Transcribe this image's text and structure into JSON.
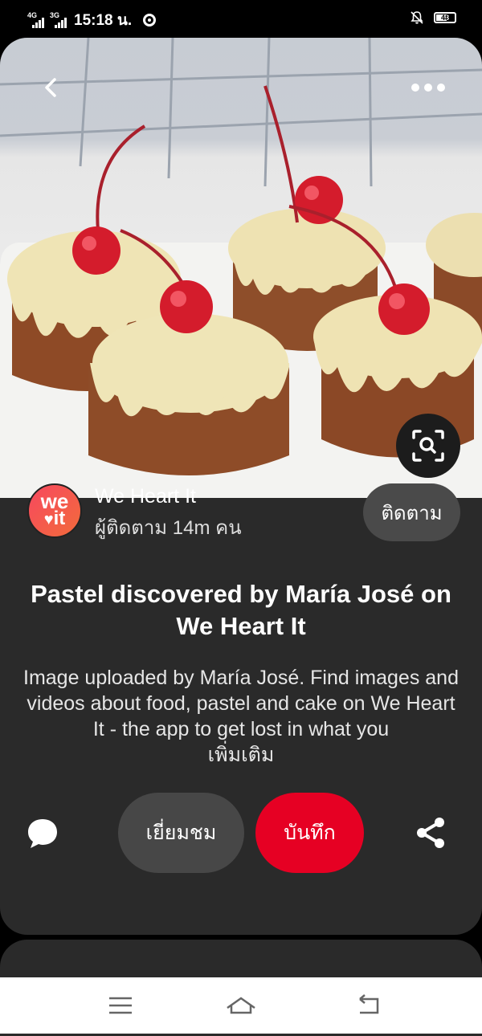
{
  "status_bar": {
    "network1": "4G",
    "network2": "3G",
    "time": "15:18 น.",
    "battery": "48"
  },
  "pin": {
    "image_alt": "mini cakes topped with white glaze and cherries",
    "publisher_name": "We Heart It",
    "publisher_logo_top": "we",
    "publisher_logo_bottom": "it",
    "followers": "ผู้ติดตาม 14m คน",
    "follow_label": "ติดตาม",
    "title": "Pastel discovered by María José on We Heart It",
    "description": "Image uploaded by María José. Find images and videos about food, pastel and cake on We Heart It - the app to get lost in what you",
    "more_label": "เพิ่มเติม",
    "visit_label": "เยี่ยมชม",
    "save_label": "บันทึก"
  },
  "colors": {
    "save": "#e60023",
    "card": "#2a2a2a",
    "secondary_button": "#474747"
  },
  "icons": [
    "back-icon",
    "more-icon",
    "visual-search-icon",
    "comment-icon",
    "share-icon",
    "menu-icon",
    "home-icon",
    "back-nav-icon"
  ]
}
